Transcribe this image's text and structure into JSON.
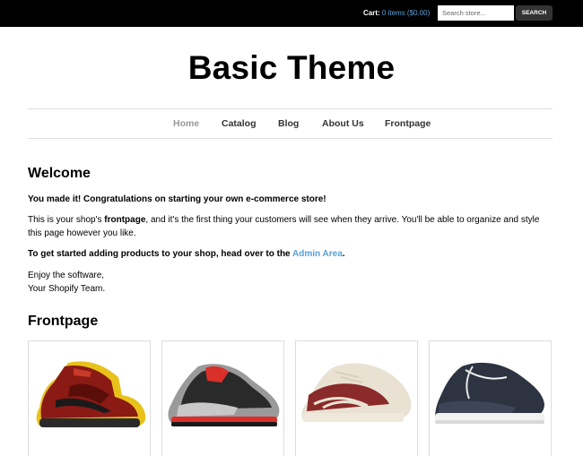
{
  "topbar": {
    "cart_label": "Cart:",
    "cart_link": "0 items ($0.00)",
    "search_placeholder": "Search store...",
    "search_button": "SEARCH"
  },
  "site_title": "Basic Theme",
  "nav": {
    "items": [
      {
        "label": "Home",
        "active": true
      },
      {
        "label": "Catalog"
      },
      {
        "label": "Blog"
      },
      {
        "label": "About Us"
      },
      {
        "label": "Frontpage"
      }
    ]
  },
  "welcome": {
    "heading": "Welcome",
    "congrats": "You made it! Congratulations on starting your own e-commerce store!",
    "intro_before": "This is your shop's ",
    "intro_bold": "frontpage",
    "intro_after": ", and it's the first thing your customers will see when they arrive. You'll be able to organize and style this page however you like.",
    "admin_before": "To get started adding products to your shop, head over to the ",
    "admin_link": "Admin Area",
    "admin_after": ".",
    "signoff_1": "Enjoy the software,",
    "signoff_2": "Your Shopify Team."
  },
  "frontpage": {
    "heading": "Frontpage",
    "products": [
      {
        "image": "red-yellow-high-top-sneaker",
        "colors": {
          "main": "#8b1a14",
          "accent": "#e8c21a"
        }
      },
      {
        "image": "black-grey-red-sneaker",
        "colors": {
          "main": "#2a2a2a",
          "accent": "#d9302a"
        }
      },
      {
        "image": "maroon-white-low-sneaker",
        "colors": {
          "main": "#8a2a2a",
          "accent": "#e9e2d2"
        }
      },
      {
        "image": "navy-boat-shoe",
        "colors": {
          "main": "#2d3340",
          "accent": "#f2f2f2"
        }
      }
    ]
  },
  "colors": {
    "link": "#5b9fd4",
    "topbar": "#000000",
    "nav_active": "#999999"
  }
}
